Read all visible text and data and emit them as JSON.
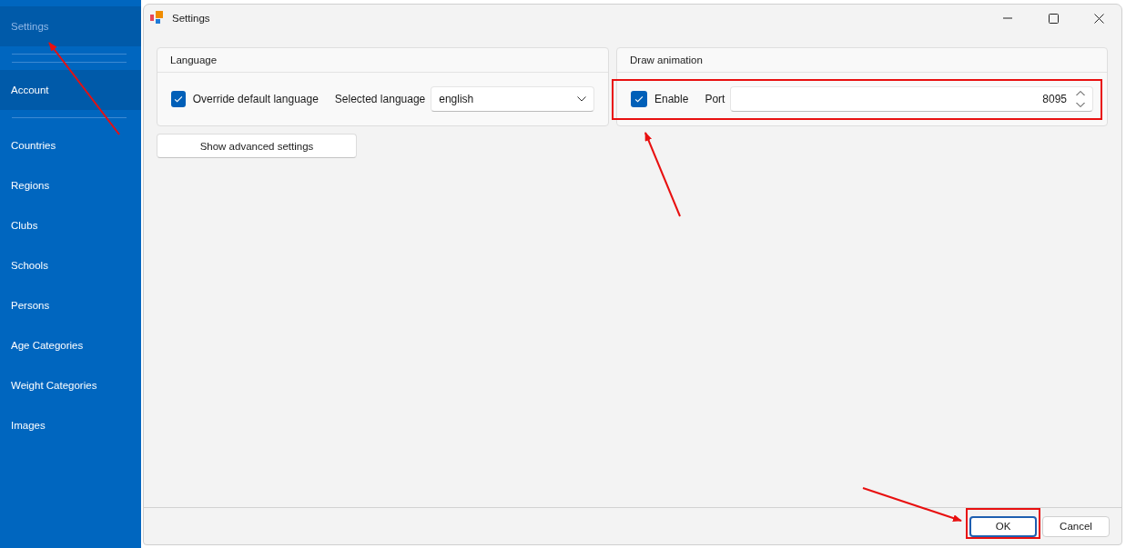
{
  "sidebar": {
    "items": [
      {
        "label": "Settings",
        "selected": true,
        "highlighted": true
      },
      {
        "label": "Account",
        "selected": false,
        "highlighted": true
      },
      {
        "label": "Countries",
        "selected": false,
        "highlighted": false
      },
      {
        "label": "Regions",
        "selected": false,
        "highlighted": false
      },
      {
        "label": "Clubs",
        "selected": false,
        "highlighted": false
      },
      {
        "label": "Schools",
        "selected": false,
        "highlighted": false
      },
      {
        "label": "Persons",
        "selected": false,
        "highlighted": false
      },
      {
        "label": "Age Categories",
        "selected": false,
        "highlighted": false
      },
      {
        "label": "Weight Categories",
        "selected": false,
        "highlighted": false
      },
      {
        "label": "Images",
        "selected": false,
        "highlighted": false
      }
    ]
  },
  "window": {
    "title": "Settings",
    "groups": [
      {
        "title": "Language",
        "checkbox": {
          "label": "Override default language",
          "checked": true
        },
        "field_label": "Selected language",
        "field": {
          "kind": "dropdown",
          "value": "english"
        }
      },
      {
        "title": "Draw animation",
        "checkbox": {
          "label": "Enable",
          "checked": true
        },
        "field_label": "Port",
        "field": {
          "kind": "spinner",
          "value": "8095"
        }
      }
    ],
    "advanced_button": "Show advanced settings",
    "buttons": [
      {
        "label": "OK",
        "default": true
      },
      {
        "label": "Cancel",
        "default": false
      }
    ]
  }
}
